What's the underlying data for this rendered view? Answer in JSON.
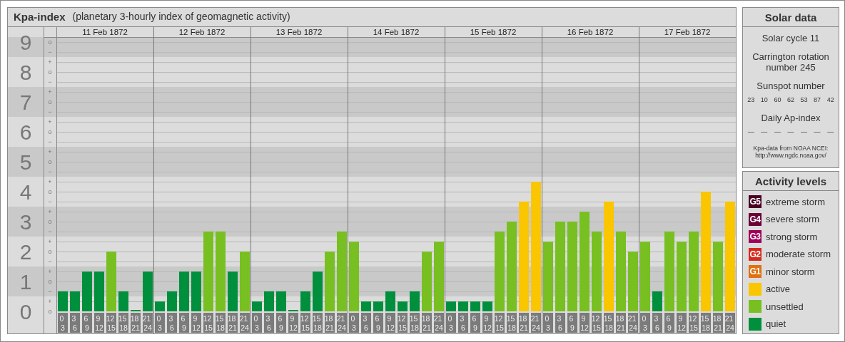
{
  "kp_panel": {
    "title": "Kpa-index",
    "subtitle": "(planetary 3-hourly index of geomagnetic activity)",
    "days": [
      "11 Feb 1872",
      "12 Feb 1872",
      "13 Feb 1872",
      "14 Feb 1872",
      "15 Feb 1872",
      "16 Feb 1872",
      "17 Feb 1872"
    ],
    "minor_tick_labels": [
      "o",
      "−",
      "+",
      "o",
      "−",
      "+",
      "o",
      "−",
      "+",
      "o",
      "−",
      "+",
      "o",
      "−",
      "+",
      "o",
      "−",
      "+",
      "o",
      "−",
      "+",
      "o",
      "−",
      "+",
      "o",
      "−",
      "+",
      "o"
    ],
    "chart_data": {
      "type": "bar",
      "stacked": true,
      "grid": true,
      "categories": [
        "0 3",
        "3 6",
        "6 9",
        "9 12",
        "12 15",
        "15 18",
        "18 21",
        "21 24",
        "0 3",
        "3 6",
        "6 9",
        "9 12",
        "12 15",
        "15 18",
        "18 21",
        "21 24",
        "0 3",
        "3 6",
        "6 9",
        "9 12",
        "12 15",
        "15 18",
        "18 21",
        "21 24",
        "0 3",
        "3 6",
        "6 9",
        "9 12",
        "12 15",
        "15 18",
        "18 21",
        "21 24",
        "0 3",
        "3 6",
        "6 9",
        "9 12",
        "12 15",
        "15 18",
        "18 21",
        "21 24",
        "0 3",
        "3 6",
        "6 9",
        "9 12",
        "12 15",
        "15 18",
        "18 21",
        "21 24",
        "0 3",
        "3 6",
        "6 9",
        "9 12",
        "12 15",
        "15 18",
        "18 21",
        "21 24"
      ],
      "ylim": [
        0,
        9.17
      ],
      "yticks": [
        {
          "value": 0,
          "label": "0"
        },
        {
          "value": 1,
          "label": "1"
        },
        {
          "value": 2,
          "label": "2"
        },
        {
          "value": 3,
          "label": "3"
        },
        {
          "value": 4,
          "label": "4"
        },
        {
          "value": 5,
          "label": "5"
        },
        {
          "value": 6,
          "label": "6"
        },
        {
          "value": 7,
          "label": "7"
        },
        {
          "value": 8,
          "label": "8"
        },
        {
          "value": 9,
          "label": "9"
        }
      ],
      "series": [
        {
          "name": "quiet",
          "color": "#008f3c",
          "values": [
            0.67,
            0.67,
            1.33,
            1.33,
            null,
            0.67,
            0,
            1.33,
            0.33,
            0.67,
            1.33,
            1.33,
            null,
            null,
            1.33,
            null,
            0.33,
            0.67,
            0.67,
            0,
            0.67,
            1.33,
            null,
            null,
            null,
            0.33,
            0.33,
            0.67,
            0.33,
            0.67,
            null,
            null,
            0.33,
            0.33,
            0.33,
            0.33,
            null,
            null,
            null,
            null,
            null,
            null,
            null,
            null,
            null,
            null,
            null,
            null,
            null,
            0.67,
            null,
            null,
            null,
            null,
            null,
            null
          ]
        },
        {
          "name": "unsettled",
          "color": "#78bf21",
          "values": [
            null,
            null,
            null,
            null,
            2,
            null,
            null,
            null,
            null,
            null,
            null,
            null,
            2.67,
            2.67,
            null,
            2,
            null,
            null,
            null,
            null,
            null,
            null,
            2,
            2.67,
            2.33,
            null,
            null,
            null,
            null,
            null,
            2,
            2.33,
            null,
            null,
            null,
            null,
            2.67,
            3,
            null,
            null,
            2.33,
            3,
            3,
            3.33,
            2.67,
            null,
            2.67,
            2,
            2.33,
            null,
            2.67,
            2.33,
            2.67,
            null,
            2.33,
            null
          ]
        },
        {
          "name": "active",
          "color": "#f9c600",
          "values": [
            null,
            null,
            null,
            null,
            null,
            null,
            null,
            null,
            null,
            null,
            null,
            null,
            null,
            null,
            null,
            null,
            null,
            null,
            null,
            null,
            null,
            null,
            null,
            null,
            null,
            null,
            null,
            null,
            null,
            null,
            null,
            null,
            null,
            null,
            null,
            null,
            null,
            null,
            3.67,
            4.33,
            null,
            null,
            null,
            null,
            null,
            3.67,
            null,
            null,
            null,
            null,
            null,
            null,
            null,
            4,
            null,
            3.67
          ]
        }
      ]
    }
  },
  "solar_data": {
    "title": "Solar data",
    "cycle": "Solar cycle 11",
    "rotation": "Carrington rotation number 245",
    "sunspot_label": "Sunspot number",
    "sunspot_numbers": [
      "23",
      "10",
      "60",
      "62",
      "53",
      "87",
      "42"
    ],
    "ap_label": "Daily Ap-index",
    "ap_values": [
      "—",
      "—",
      "—",
      "—",
      "—",
      "—",
      "—"
    ],
    "source": [
      "Kpa-data from NOAA NCEI:",
      "http://www.ngdc.noaa.gov/"
    ]
  },
  "activity_levels": {
    "title": "Activity levels",
    "items": [
      {
        "kind": "storm",
        "code": "G5",
        "label": "extreme storm",
        "color": "#4a0023"
      },
      {
        "kind": "storm",
        "code": "G4",
        "label": "severe storm",
        "color": "#6b0038"
      },
      {
        "kind": "storm",
        "code": "G3",
        "label": "strong storm",
        "color": "#a0005a"
      },
      {
        "kind": "storm",
        "code": "G2",
        "label": "moderate storm",
        "color": "#d42a1e"
      },
      {
        "kind": "storm",
        "code": "G1",
        "label": "minor storm",
        "color": "#e07010"
      }
    ]
  }
}
